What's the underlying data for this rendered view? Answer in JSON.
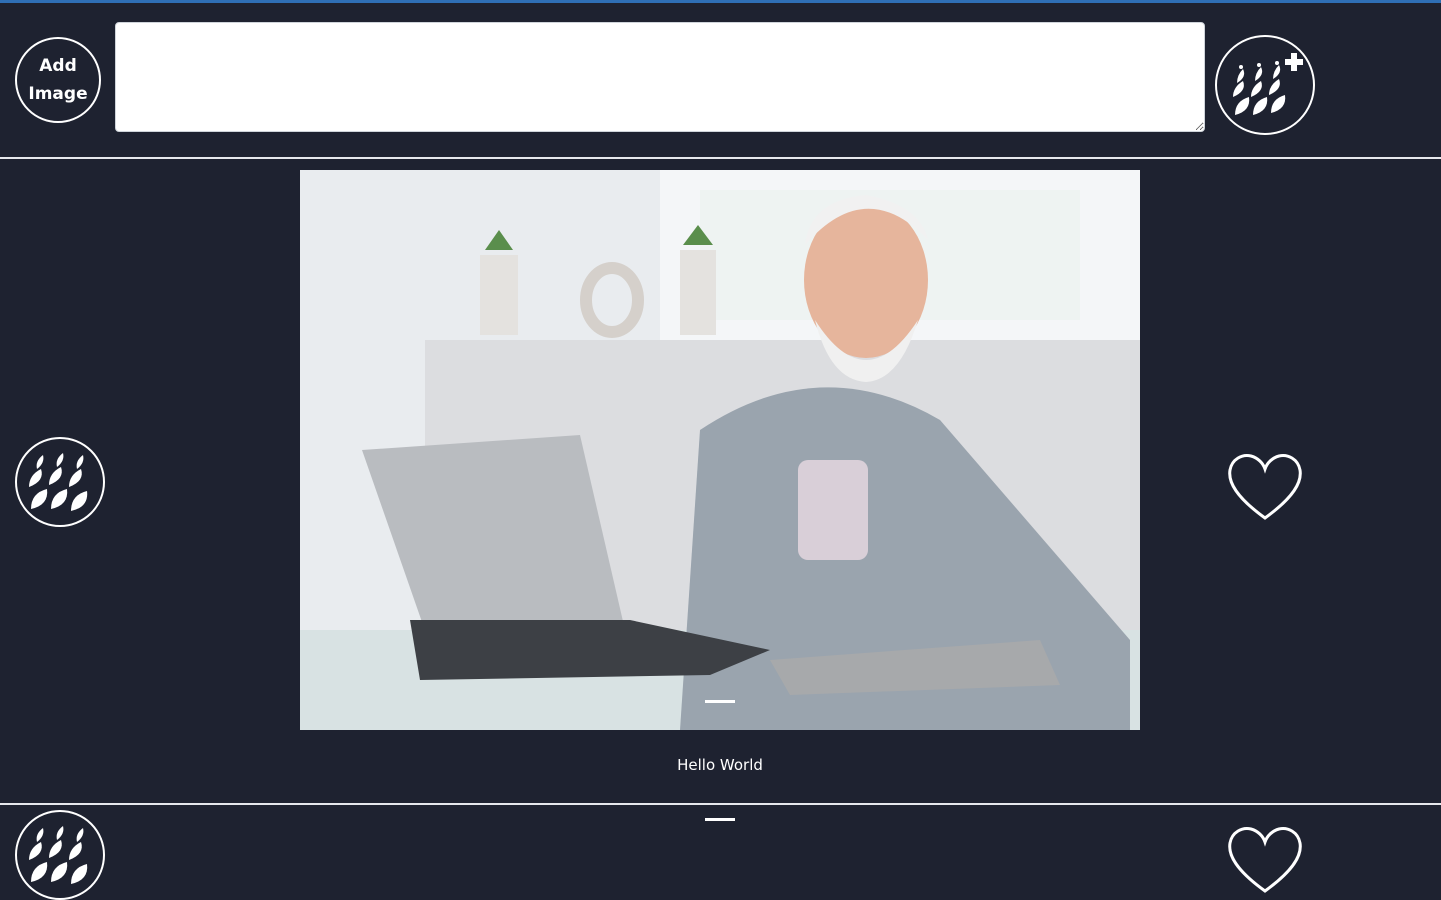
{
  "header": {
    "add_image_label_line1": "Add",
    "add_image_label_line2": "Image",
    "post_text_value": "",
    "add_post_icon": "boat-plus-icon"
  },
  "posts": [
    {
      "image_description_icon": "photo",
      "caption": "Hello World",
      "left_icon": "boat-icon",
      "right_icon": "heart-outline-icon"
    },
    {
      "caption": "",
      "left_icon": "boat-icon",
      "right_icon": "heart-outline-icon"
    }
  ],
  "colors": {
    "background": "#1e2230",
    "accent_topline": "#2f6fb5",
    "foreground": "#ffffff"
  }
}
